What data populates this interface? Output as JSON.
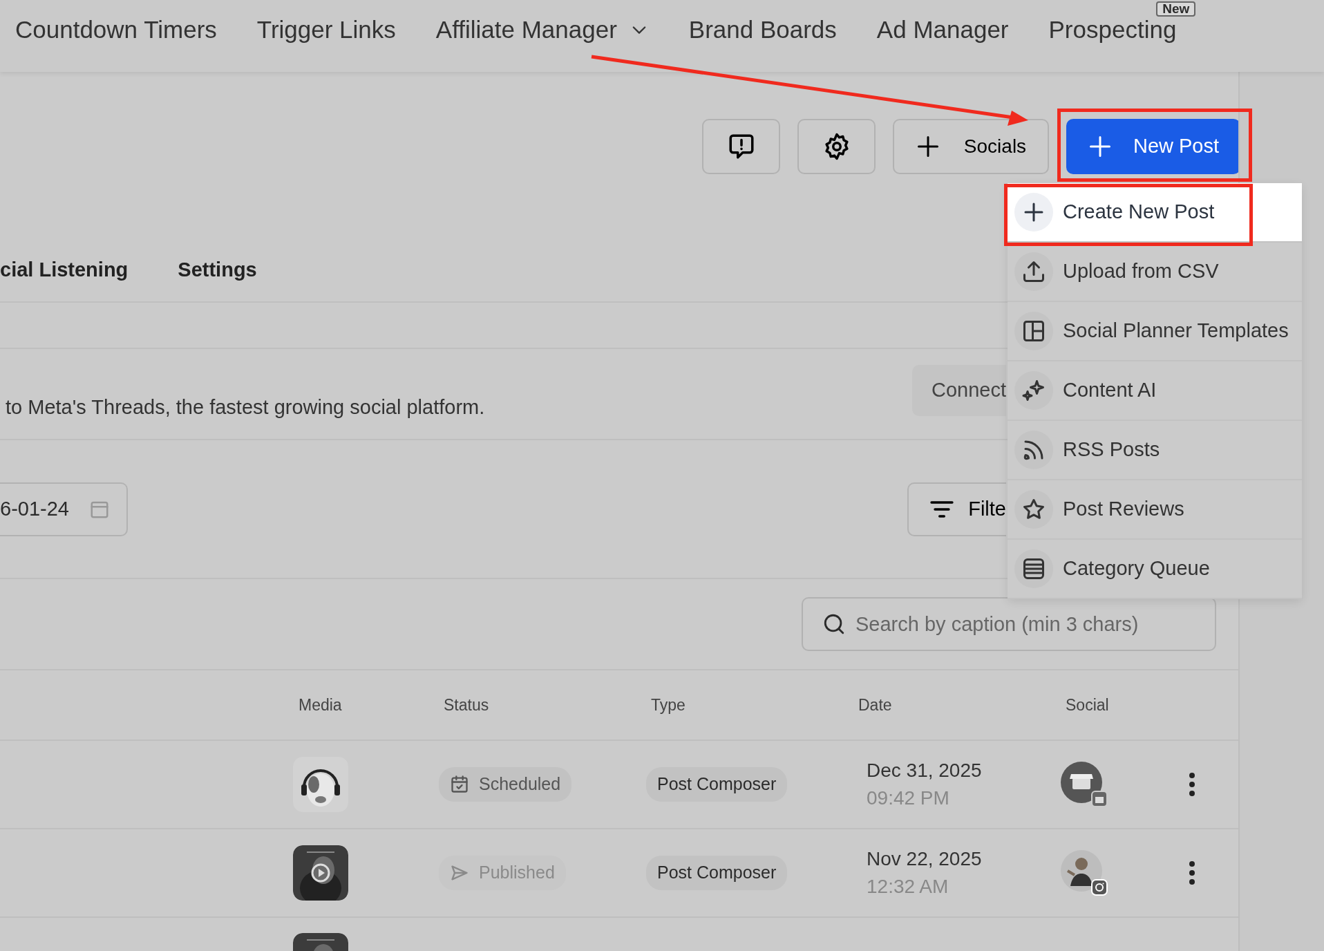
{
  "nav": {
    "items": [
      {
        "label": "Countdown Timers",
        "dropdown": false
      },
      {
        "label": "Trigger Links",
        "dropdown": false
      },
      {
        "label": "Affiliate Manager",
        "dropdown": true
      },
      {
        "label": "Brand Boards",
        "dropdown": false
      },
      {
        "label": "Ad Manager",
        "dropdown": false
      },
      {
        "label": "Prospecting",
        "dropdown": false,
        "badge": "New"
      }
    ]
  },
  "toolbar": {
    "socials_label": "Socials",
    "new_post_label": "New Post"
  },
  "new_post_menu": {
    "items": [
      {
        "label": "Create New Post",
        "selected": true
      },
      {
        "label": "Upload from CSV",
        "selected": false
      },
      {
        "label": "Social Planner Templates",
        "selected": false
      },
      {
        "label": "Content AI",
        "selected": false
      },
      {
        "label": "RSS Posts",
        "selected": false
      },
      {
        "label": "Post Reviews",
        "selected": false
      },
      {
        "label": "Category Queue",
        "selected": false
      }
    ]
  },
  "tabs": [
    {
      "label": "cial Listening"
    },
    {
      "label": "Settings"
    }
  ],
  "banner": {
    "text": "to Meta's Threads, the fastest growing social platform.",
    "button": "Connect"
  },
  "date_filter": {
    "value": "6-01-24"
  },
  "filter_button": {
    "label": "Filte"
  },
  "search": {
    "placeholder": "Search by caption (min 3 chars)"
  },
  "table": {
    "columns": [
      "Media",
      "Status",
      "Type",
      "Date",
      "Social"
    ],
    "rows": [
      {
        "media": {
          "kind": "picture"
        },
        "status": {
          "text": "Scheduled",
          "kind": "scheduled"
        },
        "type": "Post Composer",
        "date": "Dec 31, 2025",
        "time": "09:42 PM",
        "social": {
          "kind": "store"
        }
      },
      {
        "media": {
          "kind": "picture"
        },
        "status": {
          "text": "Published",
          "kind": "published"
        },
        "type": "Post Composer",
        "date": "Nov 22, 2025",
        "time": "12:32 AM",
        "social": {
          "kind": "picture"
        }
      },
      {
        "media": {
          "kind": "picture"
        }
      }
    ]
  }
}
